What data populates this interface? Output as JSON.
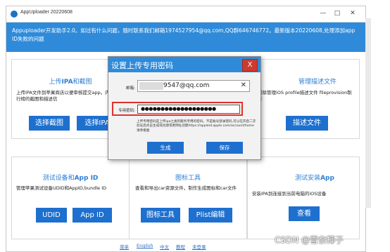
{
  "app": {
    "title": "AppUploader 20220608",
    "banner": "Appuploader开发助手2.0。如过有什么问题，随时联系我们邮箱1974527954@qq.com,QQ群646746772。最新版本20220608,处理添加app ID失败的问题",
    "window_controls": [
      "—",
      "□",
      "✕"
    ]
  },
  "panels": {
    "upload": {
      "title_prefix": "上传",
      "title_bold": "IPA",
      "title_suffix": "和截图",
      "desc": "上传IPA文件到苹果商店以便审核提交app。内购和排行榜的截图和描述信",
      "buttons": [
        "选择截图",
        "选择IPA"
      ]
    },
    "profile": {
      "title": "管理描述文件",
      "desc": "删除管理iOS profile描述文件 fileprovision制作",
      "buttons": [
        "描述文件"
      ]
    },
    "device": {
      "title_prefix": "测试设备和",
      "title_bold": "App ID",
      "desc": "管理苹果测试设备UDID和AppID,bundle ID",
      "buttons": [
        "UDID",
        "App ID"
      ]
    },
    "icon": {
      "title": "图标工具",
      "desc": "查看和导出car资源文件，制作生成图标和car文件",
      "buttons": [
        "图标工具",
        "Plist编辑"
      ]
    },
    "install": {
      "title_prefix": "测试安装",
      "title_bold": "App",
      "desc": "安装IPA到连接到当前电脑的iOS设备",
      "buttons": [
        "查看"
      ]
    }
  },
  "footer": {
    "links": [
      "菜单",
      "English",
      "中文",
      "教程",
      "未登录"
    ]
  },
  "dialog": {
    "title": "设置上传专用密码",
    "close": "X",
    "email_label": "邮箱:",
    "email_value": "9547@qq.com",
    "clear_icon": "✕",
    "password_label": "专用密码:",
    "password_value": "●●●●●●●●●●●●●●●●●●●",
    "note": "上传专用密码是上传ipa之类的服务专用的密码，不是账号登录密码,可以在开启二次验证后点击生成或创建或者网址创建https://appleid.apple.com/account/home 请参看图",
    "buttons": [
      "生成",
      "保存"
    ],
    "colors": {
      "highlight": "#e0312a",
      "accent": "#2f8bd9"
    }
  },
  "watermark": "CSDN @雪奈椰子"
}
